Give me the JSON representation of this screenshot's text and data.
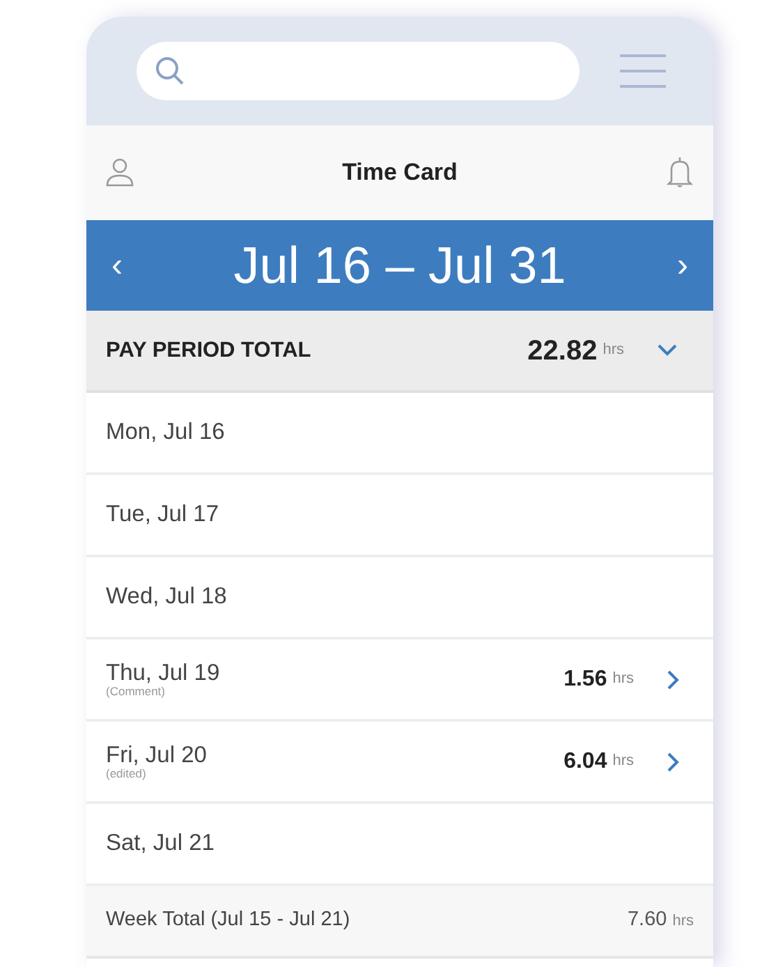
{
  "header": {
    "title": "Time Card"
  },
  "period": {
    "range": "Jul 16 – Jul 31",
    "prev": "‹",
    "next": "›"
  },
  "total": {
    "label": "PAY PERIOD TOTAL",
    "hours": "22.82",
    "unit": "hrs"
  },
  "rows": [
    {
      "kind": "day",
      "date": "Mon, Jul 16"
    },
    {
      "kind": "day",
      "date": "Tue, Jul 17"
    },
    {
      "kind": "day",
      "date": "Wed, Jul 18"
    },
    {
      "kind": "day",
      "date": "Thu, Jul 19",
      "note": "(Comment)",
      "hours": "1.56",
      "unit": "hrs"
    },
    {
      "kind": "day",
      "date": "Fri, Jul 20",
      "note": "(edited)",
      "hours": "6.04",
      "unit": "hrs"
    },
    {
      "kind": "day",
      "date": "Sat, Jul 21"
    },
    {
      "kind": "week_total",
      "date": "Week Total (Jul 15 - Jul 21)",
      "hours": "7.60",
      "unit": "hrs"
    }
  ]
}
